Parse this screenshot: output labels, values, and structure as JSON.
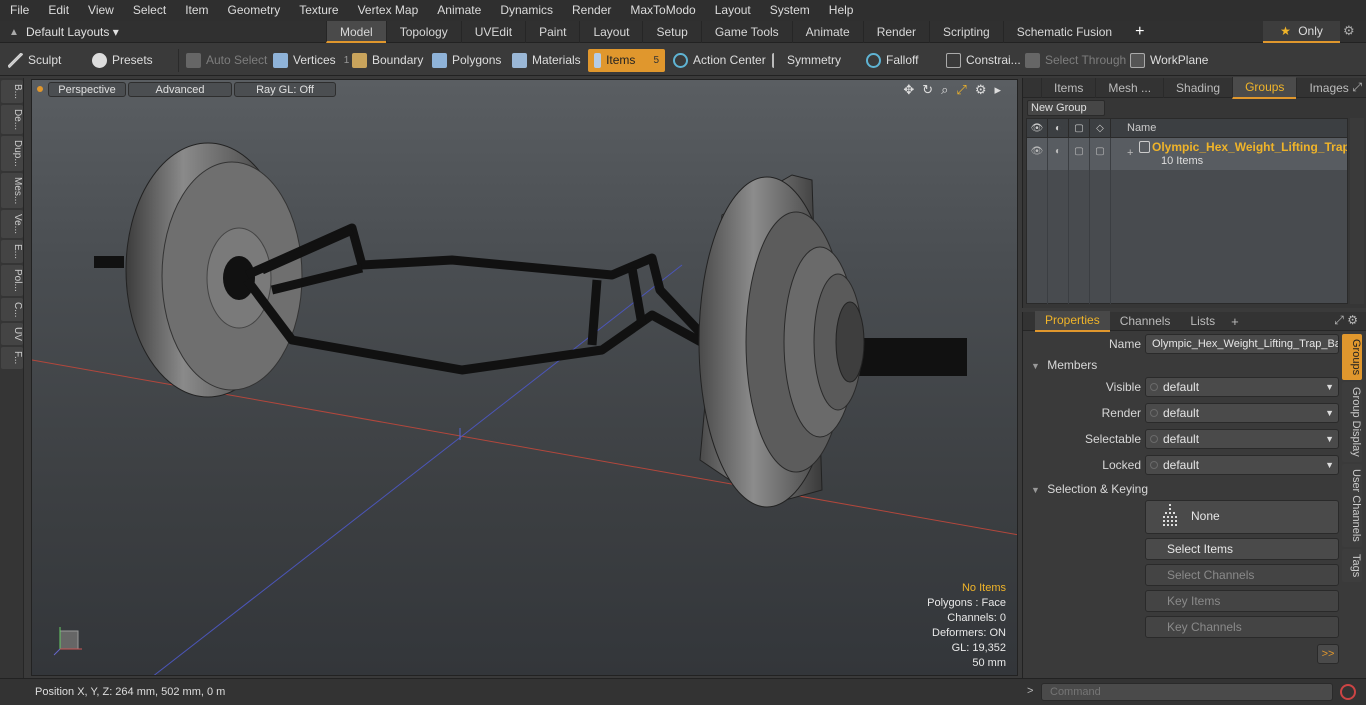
{
  "menu": [
    "File",
    "Edit",
    "View",
    "Select",
    "Item",
    "Geometry",
    "Texture",
    "Vertex Map",
    "Animate",
    "Dynamics",
    "Render",
    "MaxToModo",
    "Layout",
    "System",
    "Help"
  ],
  "layout": {
    "label": "Default Layouts ▾"
  },
  "tabs": [
    "Model",
    "Topology",
    "UVEdit",
    "Paint",
    "Layout",
    "Setup",
    "Game Tools",
    "Animate",
    "Render",
    "Scripting",
    "Schematic Fusion"
  ],
  "tabs_plus": "+",
  "only_label": "Only",
  "toolbar": {
    "sculpt": "Sculpt",
    "presets": "Presets",
    "auto_select": "Auto Select",
    "vertices": "Vertices",
    "vertices_count": "1",
    "boundary": "Boundary",
    "polygons": "Polygons",
    "materials": "Materials",
    "items": "Items",
    "items_count": "5",
    "action_center": "Action Center",
    "symmetry": "Symmetry",
    "falloff": "Falloff",
    "constraints": "Constrai...",
    "select_through": "Select Through",
    "workplane": "WorkPlane"
  },
  "left_strip": [
    "B...",
    "De...",
    "Dup...",
    "Mes...",
    "Ve...",
    "E...",
    "Pol...",
    "C...",
    "UV",
    "F..."
  ],
  "viewport": {
    "perspective": "Perspective",
    "advanced": "Advanced",
    "raygl": "Ray GL: Off",
    "stats": {
      "items": "No Items",
      "polygons": "Polygons : Face",
      "channels": "Channels: 0",
      "deformers": "Deformers: ON",
      "gl": "GL: 19,352",
      "scale": "50 mm"
    }
  },
  "status": {
    "position": "Position X, Y, Z:   264 mm, 502 mm, 0 m"
  },
  "right_top": {
    "tabs": [
      "Items",
      "Mesh ...",
      "Shading",
      "Groups",
      "Images"
    ],
    "active_tab": "Groups",
    "new_group": "New Group",
    "name_header": "Name",
    "group": {
      "name": "Olympic_Hex_Weight_Lifting_Trap_Bar",
      "sub": "10 Items"
    }
  },
  "properties": {
    "tabs": [
      "Properties",
      "Channels",
      "Lists"
    ],
    "name_label": "Name",
    "name_value": "Olympic_Hex_Weight_Lifting_Trap_Ba",
    "members": "Members",
    "visible_label": "Visible",
    "visible_value": "default",
    "render_label": "Render",
    "render_value": "default",
    "selectable_label": "Selectable",
    "selectable_value": "default",
    "locked_label": "Locked",
    "locked_value": "default",
    "selection_keying": "Selection & Keying",
    "none_btn": "None",
    "select_items": "Select Items",
    "select_channels": "Select Channels",
    "key_items": "Key Items",
    "key_channels": "Key Channels",
    "more": ">>"
  },
  "vtabs": [
    "Groups",
    "Group Display",
    "User Channels",
    "Tags"
  ],
  "command": {
    "placeholder": "Command",
    "prompt": ">"
  },
  "colors": {
    "accent": "#e0972d",
    "highlight": "#f0b429"
  }
}
